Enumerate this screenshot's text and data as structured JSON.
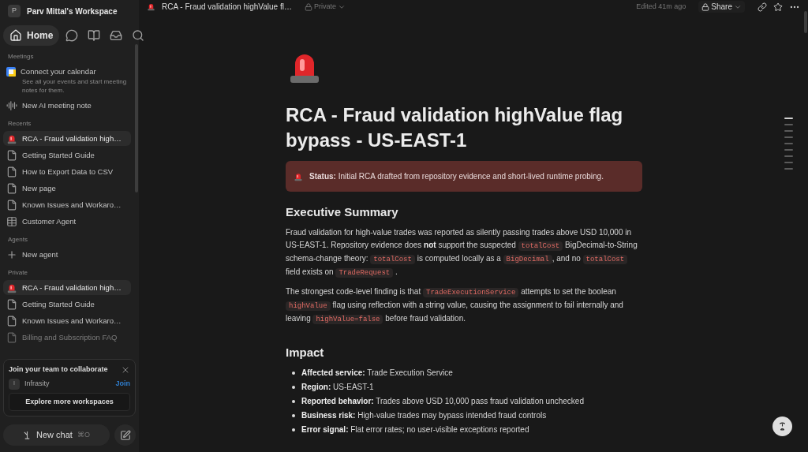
{
  "sidebar": {
    "workspace": {
      "initial": "P",
      "name": "Parv Mittal's Workspace"
    },
    "nav": [
      {
        "kind": "home",
        "label": "Home",
        "selected": true
      },
      {
        "kind": "chat",
        "selected": false
      },
      {
        "kind": "library",
        "selected": false
      },
      {
        "kind": "inbox",
        "selected": false
      },
      {
        "kind": "search",
        "selected": false
      }
    ],
    "sections": [
      {
        "title": "Meetings",
        "items": [
          {
            "kind": "calendar",
            "label": "Connect your calendar",
            "description": "See all your events and start meeting notes for them.",
            "selected": false,
            "faded": false
          },
          {
            "kind": "wave",
            "label": "New AI meeting note",
            "selected": false,
            "faded": false
          }
        ]
      },
      {
        "title": "Recents",
        "items": [
          {
            "kind": "siren",
            "label": "RCA - Fraud validation high…",
            "selected": true,
            "faded": false
          },
          {
            "kind": "page",
            "label": "Getting Started Guide",
            "selected": false,
            "faded": false
          },
          {
            "kind": "page",
            "label": "How to Export Data to CSV",
            "selected": false,
            "faded": false
          },
          {
            "kind": "page",
            "label": "New page",
            "selected": false,
            "faded": false
          },
          {
            "kind": "page",
            "label": "Known Issues and Workaro…",
            "selected": false,
            "faded": false
          },
          {
            "kind": "table",
            "label": "Customer Agent",
            "selected": false,
            "faded": false
          }
        ]
      },
      {
        "title": "Agents",
        "items": [
          {
            "kind": "plus",
            "label": "New agent",
            "selected": false,
            "faded": false
          }
        ]
      },
      {
        "title": "Private",
        "items": [
          {
            "kind": "siren",
            "label": "RCA - Fraud validation high…",
            "selected": true,
            "faded": false
          },
          {
            "kind": "page",
            "label": "Getting Started Guide",
            "selected": false,
            "faded": false
          },
          {
            "kind": "page",
            "label": "Known Issues and Workaro…",
            "selected": false,
            "faded": false
          },
          {
            "kind": "page",
            "label": "Billing and Subscription FAQ",
            "selected": false,
            "faded": true
          }
        ]
      }
    ],
    "team_card": {
      "title": "Join your team to collaborate",
      "workspace_initial": "I",
      "workspace": "Infrasity",
      "join": "Join",
      "explore": "Explore more workspaces"
    },
    "new_chat": {
      "label": "New chat",
      "shortcut": "⌘O"
    }
  },
  "topbar": {
    "page_title": "RCA - Fraud validation highValue fl…",
    "privacy": "Private",
    "edited": "Edited 41m ago",
    "share": "Share"
  },
  "page": {
    "title": "RCA - Fraud validation highValue flag bypass - US-EAST-1",
    "callout": "**Status:** Initial RCA drafted from repository evidence and short-lived runtime probing.",
    "blocks": [
      {
        "kind": "heading",
        "text": "Executive Summary"
      },
      {
        "kind": "paragraph",
        "segments": [
          {
            "kind": "text",
            "text": "Fraud validation for high-value trades was reported as silently passing trades above USD 10,000 in US-EAST-1. Repository evidence does "
          },
          {
            "kind": "bold",
            "text": "not"
          },
          {
            "kind": "text",
            "text": " support the suspected "
          },
          {
            "kind": "code",
            "text": "totalCost"
          },
          {
            "kind": "text",
            "text": " BigDecimal-to-String schema-change theory: "
          },
          {
            "kind": "code",
            "text": "totalCost"
          },
          {
            "kind": "text",
            "text": " is computed locally as a "
          },
          {
            "kind": "code",
            "text": "BigDecimal"
          },
          {
            "kind": "text",
            "text": ", and no "
          },
          {
            "kind": "code",
            "text": "totalCost"
          },
          {
            "kind": "text",
            "text": " field exists on "
          },
          {
            "kind": "code",
            "text": "TradeRequest"
          },
          {
            "kind": "text",
            "text": " ."
          }
        ]
      },
      {
        "kind": "paragraph",
        "segments": [
          {
            "kind": "text",
            "text": "The strongest code-level finding is that "
          },
          {
            "kind": "code",
            "text": "TradeExecutionService"
          },
          {
            "kind": "text",
            "text": " attempts to set the boolean "
          },
          {
            "kind": "code",
            "text": "highValue"
          },
          {
            "kind": "text",
            "text": " flag using reflection with a string value, causing the assignment to fail internally and leaving "
          },
          {
            "kind": "code",
            "text": "highValue=false"
          },
          {
            "kind": "text",
            "text": " before fraud validation."
          }
        ]
      },
      {
        "kind": "heading",
        "text": "Impact"
      },
      {
        "kind": "bullets",
        "items": [
          "**Affected service:** Trade Execution Service",
          "**Region:** US-EAST-1",
          "**Reported behavior:** Trades above USD 10,000 pass fraud validation unchecked",
          "**Business risk:** High-value trades may bypass intended fraud controls",
          "**Error signal:** Flat error rates; no user-visible exceptions reported"
        ]
      }
    ]
  },
  "outline": [
    {
      "selected": true
    },
    {
      "selected": false
    },
    {
      "selected": false
    },
    {
      "selected": false
    },
    {
      "selected": false
    },
    {
      "selected": false
    },
    {
      "selected": false
    },
    {
      "selected": false
    },
    {
      "selected": false
    }
  ]
}
